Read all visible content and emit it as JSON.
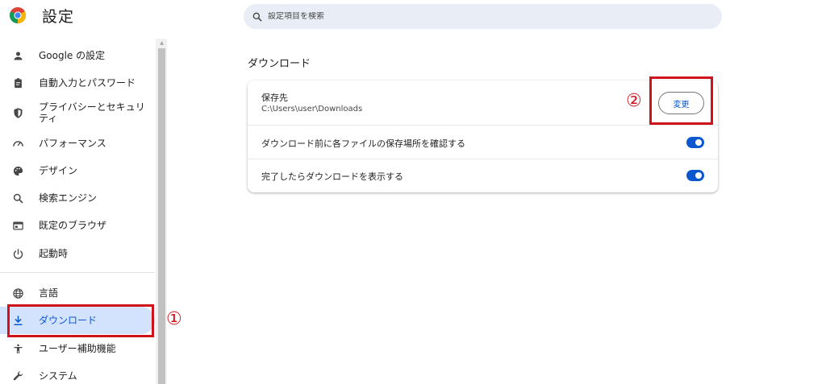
{
  "app": {
    "title": "設定",
    "logo_icon": "chrome-logo-icon"
  },
  "search": {
    "placeholder": "設定項目を検索",
    "icon": "search-icon"
  },
  "sidebar": {
    "items": [
      {
        "label": "Google の設定",
        "icon": "person-icon"
      },
      {
        "label": "自動入力とパスワード",
        "icon": "clipboard-icon"
      },
      {
        "label": "プライバシーとセキュリティ",
        "icon": "shield-icon"
      },
      {
        "label": "パフォーマンス",
        "icon": "speedometer-icon"
      },
      {
        "label": "デザイン",
        "icon": "palette-icon"
      },
      {
        "label": "検索エンジン",
        "icon": "search-icon"
      },
      {
        "label": "既定のブラウザ",
        "icon": "browser-icon"
      },
      {
        "label": "起動時",
        "icon": "power-icon"
      },
      {
        "label": "言語",
        "icon": "globe-icon"
      },
      {
        "label": "ダウンロード",
        "icon": "download-icon",
        "active": true
      },
      {
        "label": "ユーザー補助機能",
        "icon": "accessibility-icon"
      },
      {
        "label": "システム",
        "icon": "wrench-icon"
      }
    ]
  },
  "main": {
    "section_title": "ダウンロード",
    "location": {
      "label": "保存先",
      "path": "C:\\Users\\user\\Downloads",
      "change_label": "変更"
    },
    "toggles": [
      {
        "label": "ダウンロード前に各ファイルの保存場所を確認する",
        "on": true
      },
      {
        "label": "完了したらダウンロードを表示する",
        "on": true
      }
    ]
  },
  "annotations": {
    "marker_1": "①",
    "marker_2": "②",
    "color": "#d0121b"
  },
  "colors": {
    "accent": "#0b57d0",
    "active_bg": "#d3e3fd",
    "search_bg": "#e9eef6"
  }
}
